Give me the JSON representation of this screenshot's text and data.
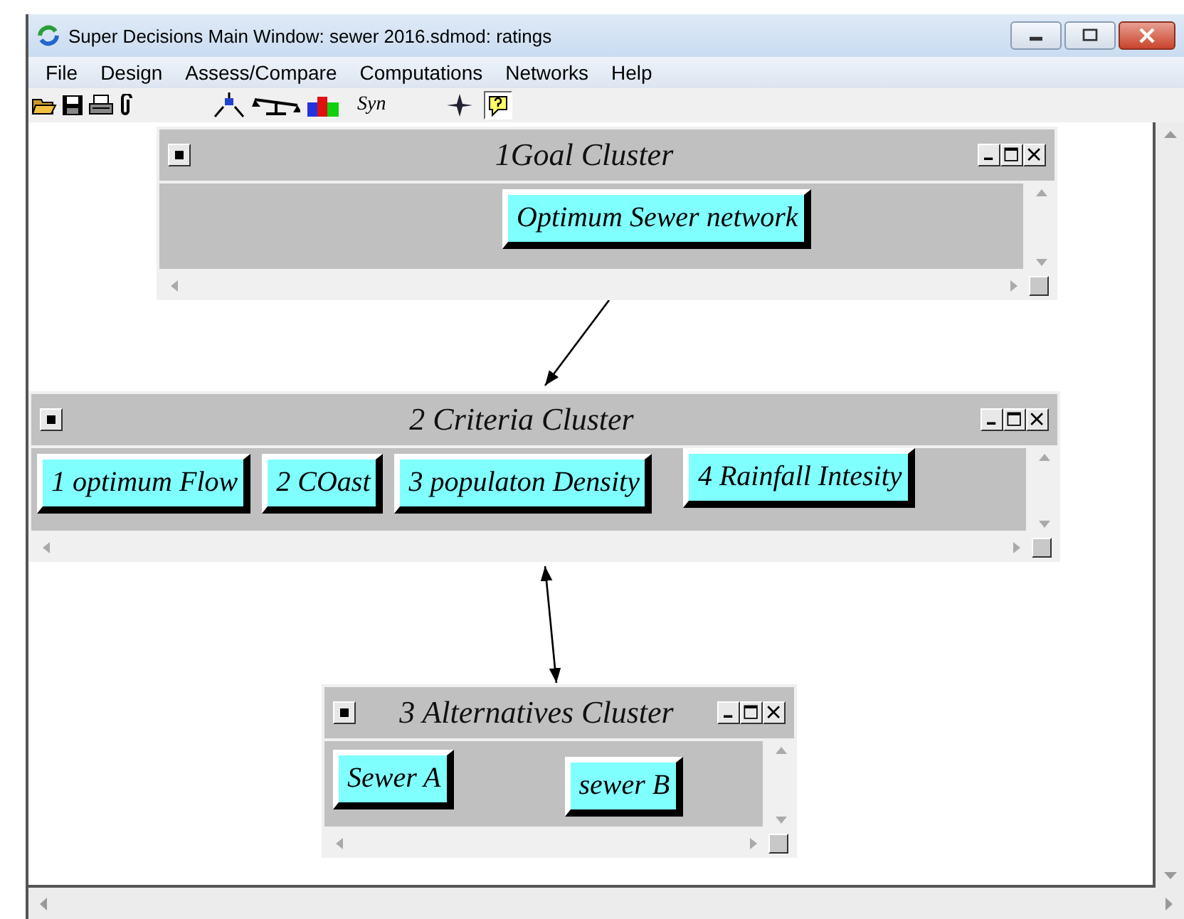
{
  "window": {
    "title": "Super Decisions Main Window: sewer 2016.sdmod: ratings"
  },
  "menu": [
    "File",
    "Design",
    "Assess/Compare",
    "Computations",
    "Networks",
    "Help"
  ],
  "toolbar": {
    "syn_label": "Syn",
    "help_pressed": true
  },
  "clusters": [
    {
      "title": "1Goal Cluster",
      "nodes": [
        "Optimum Sewer network"
      ]
    },
    {
      "title": "2 Criteria Cluster",
      "nodes": [
        "1 optimum Flow",
        "2 COast",
        "3 populaton Density",
        "4 Rainfall Intesity"
      ]
    },
    {
      "title": "3 Alternatives Cluster",
      "nodes": [
        "Sewer A",
        "sewer B"
      ]
    }
  ],
  "connections": [
    {
      "both_ways": false
    },
    {
      "both_ways": true
    }
  ]
}
